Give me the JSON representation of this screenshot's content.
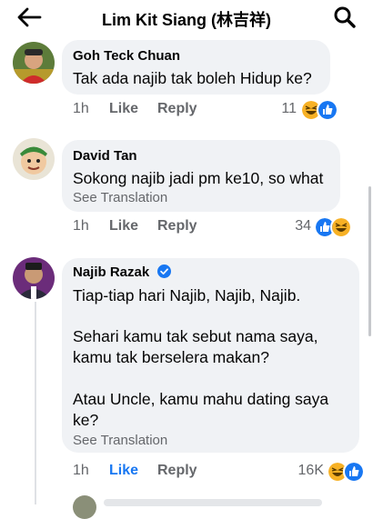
{
  "header": {
    "title": "Lim Kit Siang (林吉祥)",
    "back_icon": "arrow-left-icon",
    "search_icon": "search-icon"
  },
  "comments": [
    {
      "author": "Goh Teck Chuan",
      "lines": [
        "Tak ada najib tak boleh Hidup ke?"
      ],
      "see_translation": "",
      "time": "1h",
      "like_label": "Like",
      "reply_label": "Reply",
      "reaction_count": "11",
      "reactions": [
        "haha",
        "like"
      ]
    },
    {
      "author": "David Tan",
      "lines": [
        "Sokong najib jadi pm ke10, so what"
      ],
      "see_translation": "See Translation",
      "time": "1h",
      "like_label": "Like",
      "reply_label": "Reply",
      "reaction_count": "34",
      "reactions": [
        "like",
        "haha"
      ]
    },
    {
      "author": "Najib Razak",
      "verified": true,
      "paragraphs": [
        [
          "Tiap-tiap hari Najib, Najib, Najib."
        ],
        [
          "Sehari kamu tak sebut nama saya,",
          "kamu tak berselera makan?"
        ],
        [
          "Atau Uncle, kamu mahu dating saya",
          "ke?"
        ]
      ],
      "see_translation": "See Translation",
      "time": "1h",
      "like_label": "Like",
      "liked": true,
      "reply_label": "Reply",
      "reaction_count": "16K",
      "reactions": [
        "haha",
        "like"
      ]
    }
  ],
  "colors": {
    "bubble": "#f0f2f5",
    "meta_gray": "#65676b",
    "fb_blue": "#1877f2",
    "haha_yellow": "#f7b125"
  }
}
